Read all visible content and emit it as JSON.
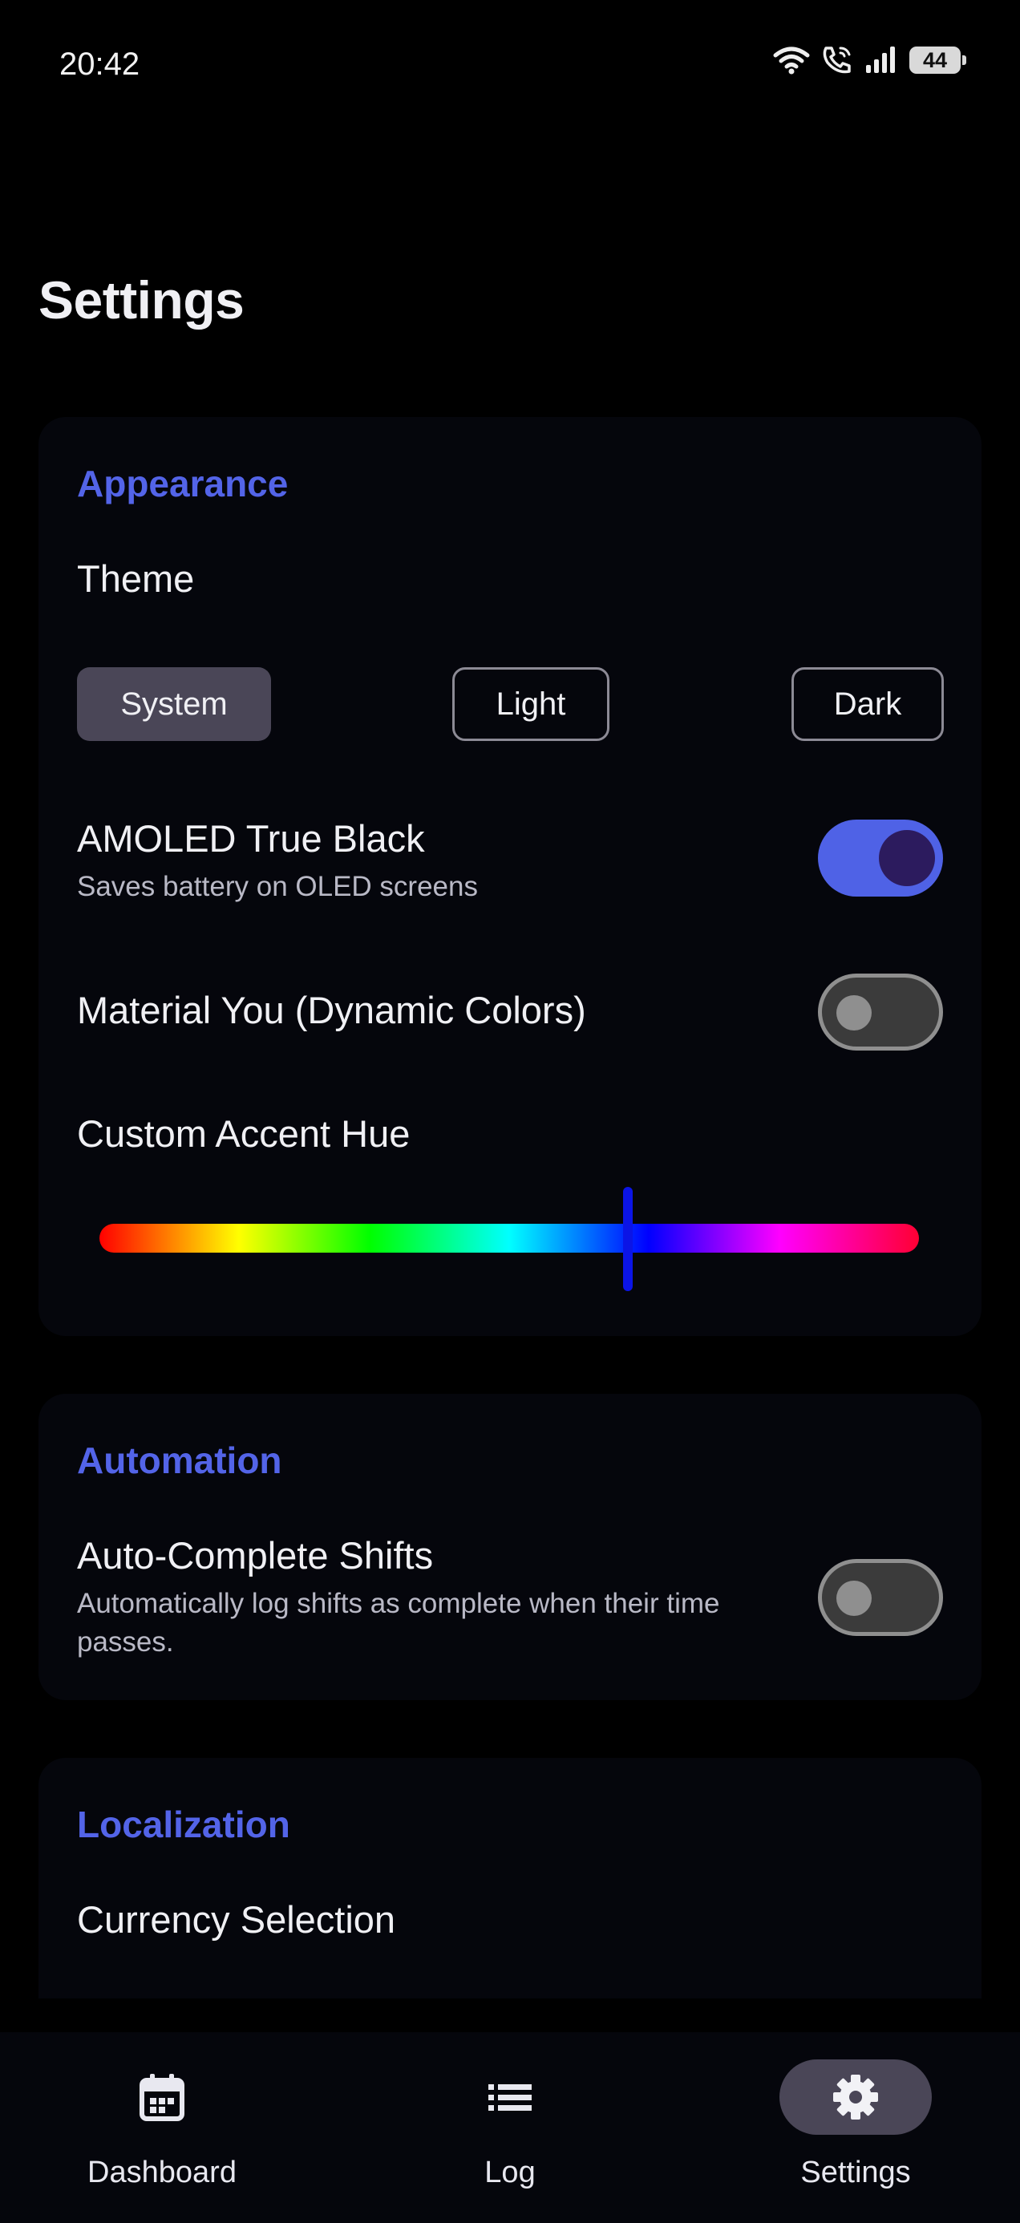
{
  "status_bar": {
    "time": "20:42",
    "battery": "44",
    "icons": [
      "wifi-icon",
      "wifi-call-icon",
      "signal-icon",
      "battery-icon"
    ]
  },
  "page": {
    "title": "Settings"
  },
  "appearance": {
    "title": "Appearance",
    "theme_label": "Theme",
    "theme_options": [
      "System",
      "Light",
      "Dark"
    ],
    "theme_selected": "System",
    "amoled": {
      "label": "AMOLED True Black",
      "subtitle": "Saves battery on OLED screens",
      "enabled": true
    },
    "material_you": {
      "label": "Material You (Dynamic Colors)",
      "enabled": false
    },
    "accent": {
      "label": "Custom Accent Hue",
      "value_fraction": 0.645
    }
  },
  "automation": {
    "title": "Automation",
    "auto_complete": {
      "label": "Auto-Complete Shifts",
      "subtitle_line1": "Automatically log shifts as complete when their time",
      "subtitle_line2": "passes.",
      "enabled": false
    }
  },
  "localization": {
    "title": "Localization",
    "currency_label": "Currency Selection"
  },
  "nav": {
    "items": [
      {
        "label": "Dashboard",
        "icon": "calendar-icon"
      },
      {
        "label": "Log",
        "icon": "list-icon"
      },
      {
        "label": "Settings",
        "icon": "gear-icon"
      }
    ],
    "active": "Settings"
  },
  "colors": {
    "background": "#000000",
    "card": "#05060C",
    "accent": "#5364E8",
    "toggle_on": "#4F62E6",
    "selected_pill": "#4A4657"
  }
}
